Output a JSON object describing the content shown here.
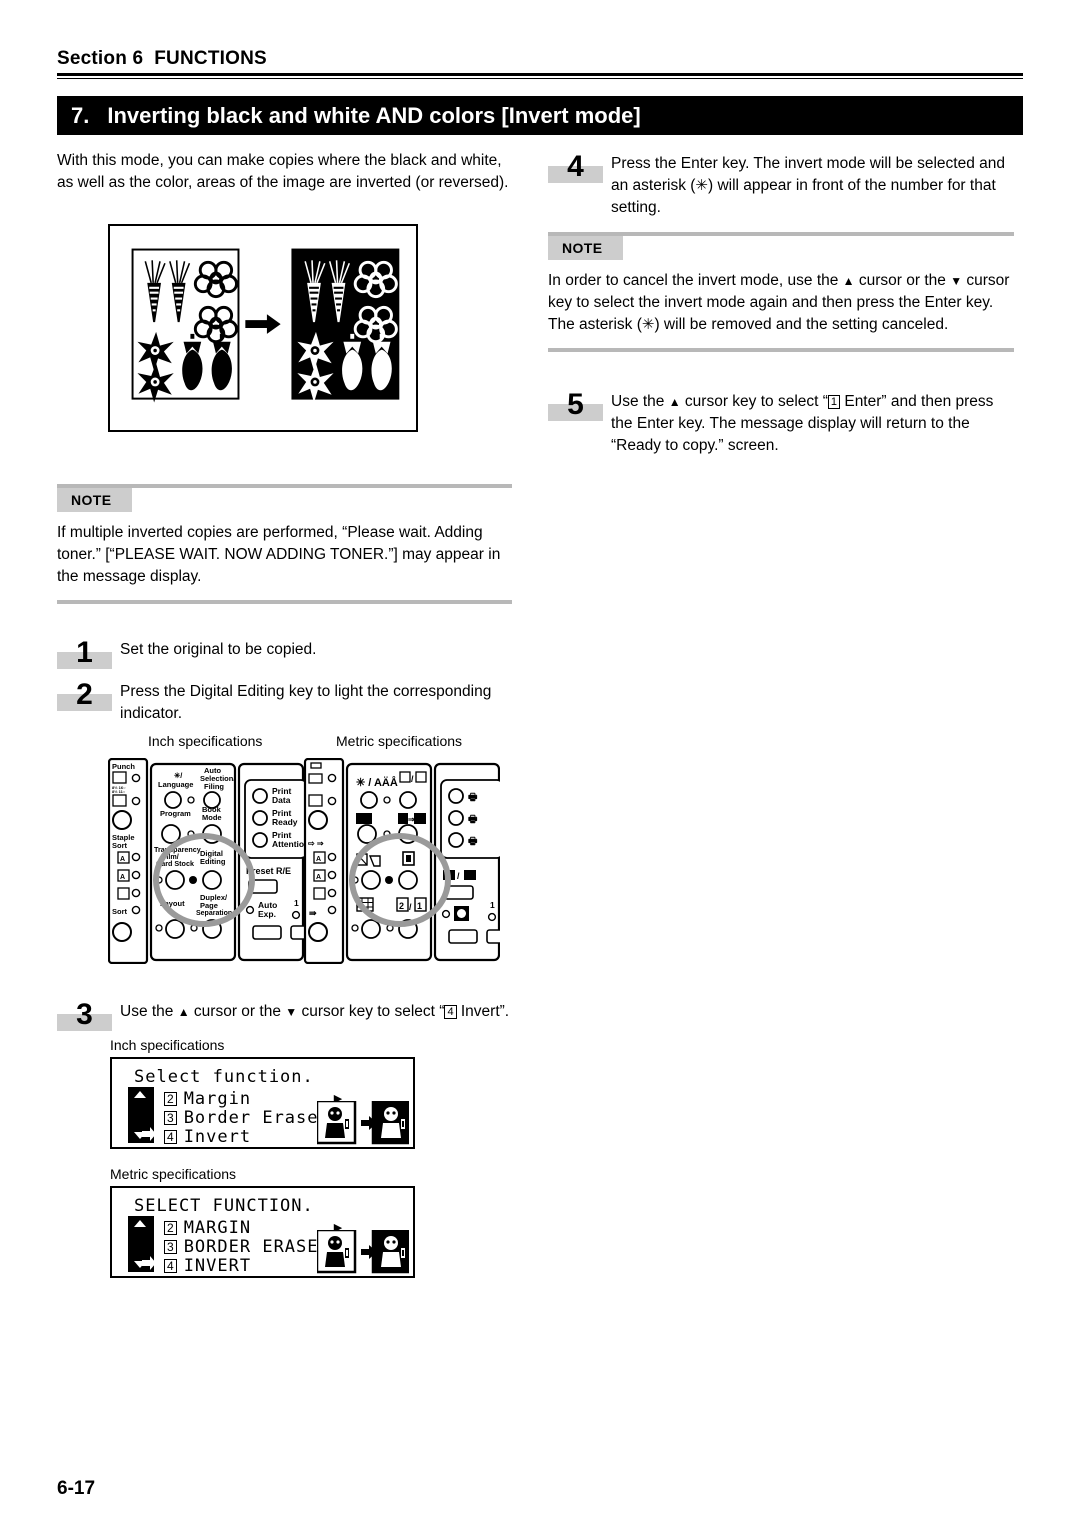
{
  "running_head": {
    "section_label": "Section 6",
    "section_title": "FUNCTIONS"
  },
  "banner": {
    "number": "7.",
    "title": "Inverting black and white AND colors [Invert mode]"
  },
  "left_column": {
    "intro": "With this mode, you can make copies where the black and white, as well as the color, areas of the image are inverted (or reversed).",
    "illustration": {
      "alt": "Original page with black vegetables and flowers, arrow pointing to inverted copy with white vegetables on black background",
      "arrow": "→"
    },
    "note": {
      "tag": "NOTE",
      "body": "If multiple inverted copies are performed, “Please wait. Adding toner.” [“PLEASE WAIT. NOW ADDING TONER.”] may appear in the message display."
    },
    "steps": [
      {
        "number": "1",
        "text": "Set the original to be copied."
      },
      {
        "number": "2",
        "text": "Press the Digital Editing key to light the corresponding indicator."
      }
    ],
    "panel_captions": {
      "inch": "Inch specifications",
      "metric": "Metric specifications"
    },
    "step3": {
      "number": "3",
      "text_before": "Use the ",
      "text_mid1": " cursor or the ",
      "text_mid2": " cursor key to select “",
      "key": "4",
      "text_after": " Invert”."
    },
    "lcd_inch": {
      "caption": "Inch specifications",
      "title": "Select function.",
      "rows": [
        {
          "key": "2",
          "label": "Margin",
          "arrow": "▶"
        },
        {
          "key": "3",
          "label": "Border Erase",
          "arrow": "▶"
        },
        {
          "key": "4",
          "label": "Invert",
          "arrow": ""
        }
      ]
    },
    "lcd_metric": {
      "caption": "Metric specifications",
      "title": "SELECT FUNCTION.",
      "rows": [
        {
          "key": "2",
          "label": "MARGIN",
          "arrow": "▶"
        },
        {
          "key": "3",
          "label": "BORDER ERASE",
          "arrow": "▶"
        },
        {
          "key": "4",
          "label": "INVERT",
          "arrow": ""
        }
      ]
    }
  },
  "right_column": {
    "step4": {
      "number": "4",
      "text_a": "Press the Enter key. The invert mode will be selected and an asterisk (",
      "asterisk": "✳",
      "text_b": ") will appear in front of the number for that setting."
    },
    "note": {
      "tag": "NOTE",
      "text_a": "In order to cancel the invert mode, use the ",
      "text_b": " cursor or the ",
      "text_c": " cursor key to select the invert mode again and then press the Enter key. The asterisk (",
      "asterisk": "✳",
      "text_d": ") will be removed and the setting canceled."
    },
    "step5": {
      "number": "5",
      "text_a": "Use the ",
      "text_b": " cursor key to select “",
      "key": "1",
      "text_c": " Enter” and then press the Enter key. The message display will return to the “Ready to copy.” screen."
    }
  },
  "control_panel": {
    "inch": {
      "left_group_labels": [
        "Punch",
        "Staple Sort",
        "Sort"
      ],
      "center_group_labels": [
        "✳/ Language",
        "Auto Selection/ Filing",
        "Program",
        "Book Mode",
        "Transparency Film/ Card Stock",
        "Digital Editing",
        "Layout",
        "Duplex/ Page Separation"
      ],
      "right_group_labels": [
        "Print Data",
        "Print Ready",
        "Print Attention",
        "Preset R/E",
        "Auto Exp.",
        "1"
      ],
      "highlight": "Digital Editing key circled"
    },
    "metric": {
      "center_group_labels": [
        "✳ / AÄÅ",
        "❐/❑",
        "❐",
        "❑",
        "❒",
        "❓"
      ],
      "right_group_labels": [
        "1"
      ],
      "highlight": "Digital Editing key circled"
    }
  },
  "footer": {
    "page_number": "6-17"
  },
  "colors": {
    "banner_bg": "#000000",
    "banner_fg": "#ffffff",
    "badge_bg": "#cdcdcd",
    "note_rule": "#b8b8b8",
    "highlight_circle": "#9a9a9a"
  }
}
